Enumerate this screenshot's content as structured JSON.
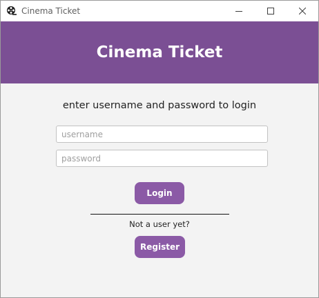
{
  "window": {
    "title": "Cinema Ticket",
    "icon": "film-reel-icon",
    "controls": [
      "minimize-icon",
      "maximize-icon",
      "close-icon"
    ]
  },
  "header": {
    "title": "Cinema Ticket"
  },
  "login": {
    "instruction": "enter username and password to login",
    "username_placeholder": "username",
    "username_value": "",
    "password_placeholder": "password",
    "password_value": "",
    "login_label": "Login"
  },
  "register": {
    "prompt": "Not a user yet?",
    "register_label": "Register"
  },
  "colors": {
    "banner": "#7b4f94",
    "button": "#8b5aa6",
    "background": "#f3f3f3"
  }
}
